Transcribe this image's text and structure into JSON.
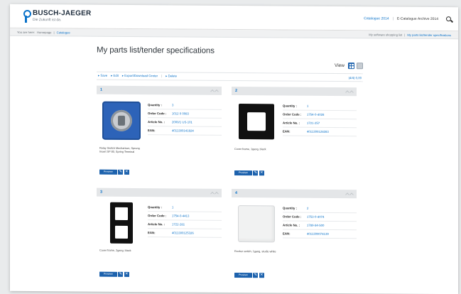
{
  "header": {
    "logo_title": "BUSCH-JAEGER",
    "logo_tagline": "Die Zukunft ist da.",
    "catalogue_link": "Catalogue 2014",
    "catalogue_archive": "E-Catalogue Archive 2014"
  },
  "subbar": {
    "you_are_here": "You are here:",
    "crumb_homepage": "Homepage",
    "crumb_separator": "|",
    "crumb_catalogue": "Catalogue",
    "my_software": "My software shopping list",
    "my_parts_link": "My parts list/tender specifications"
  },
  "main": {
    "title": "My parts list/tender specifications",
    "view_label": "View"
  },
  "actionbar": {
    "save": "Save",
    "edit": "Edit",
    "export": "Export/Download Center",
    "separator": "|",
    "delete": "Delete",
    "right": "(4/4) 0,00"
  },
  "labels": {
    "quantity": "Quantity :",
    "order_code": "Order Code :",
    "article_no": "Article No. :",
    "ean": "EAN:",
    "preview": "Preview",
    "edit_glyph": "✎",
    "delete_glyph": "✕"
  },
  "cards": [
    {
      "number": "1",
      "image": "mechanism-insert",
      "description": "Relay Switch Mechanism, Sprung Insert SP 80, Spring Terminal",
      "quantity": "3",
      "order_code": "1012 0 0083",
      "article_no": "2000/1 US-101",
      "ean": "4011300141824"
    },
    {
      "number": "2",
      "image": "single-frame-black",
      "description": "Cover frame, 1gang, black",
      "quantity": "1",
      "order_code": "1754-0-4028",
      "article_no": "1721-257",
      "ean": "4011300128283"
    },
    {
      "number": "3",
      "image": "double-frame-black",
      "description": "Cover frame, 2gang, black",
      "quantity": "1",
      "order_code": "1754-0-4413",
      "article_no": "1722-281",
      "ean": "4011300125326"
    },
    {
      "number": "4",
      "image": "rocker-white",
      "description": "Rocker switch, 1gang, studio white",
      "quantity": "2",
      "order_code": "1753-0-4074",
      "article_no": "1789-84-500",
      "ean": "4011300074139"
    }
  ]
}
